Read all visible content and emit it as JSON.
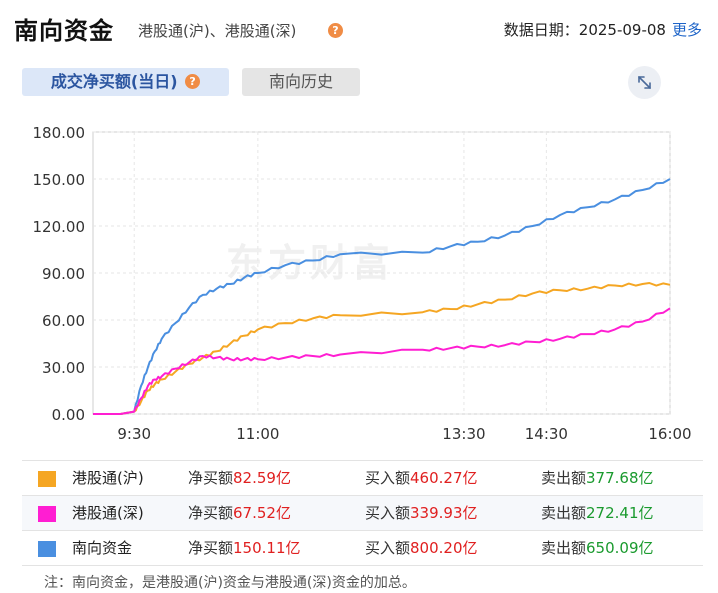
{
  "header": {
    "title": "南向资金",
    "subtitle": "港股通(沪)、港股通(深)",
    "help": "?",
    "date_label": "数据日期：",
    "date_value": "2025-09-08",
    "more_label": "更多"
  },
  "tabs": [
    {
      "label": "成交净买额(当日)",
      "active": true
    },
    {
      "label": "南向历史",
      "active": false
    }
  ],
  "watermark": "东方财富",
  "chart_data": {
    "type": "line",
    "x_ticks": [
      "9:30",
      "11:00",
      "13:30",
      "14:30",
      "16:00"
    ],
    "y_ticks": [
      "0.00",
      "30.00",
      "60.00",
      "90.00",
      "120.00",
      "150.00",
      "180.00"
    ],
    "ylim": [
      0,
      180
    ],
    "grid": true,
    "series": [
      {
        "name": "南向资金",
        "color": "#4a8fe0",
        "x": [
          "9:00",
          "9:20",
          "9:30",
          "9:35",
          "9:40",
          "9:45",
          "9:50",
          "10:00",
          "10:10",
          "10:20",
          "10:30",
          "10:40",
          "10:50",
          "11:00",
          "11:20",
          "11:40",
          "12:00",
          "13:00",
          "13:20",
          "13:40",
          "14:00",
          "14:20",
          "14:40",
          "15:00",
          "15:20",
          "15:40",
          "16:00"
        ],
        "values": [
          0,
          0,
          1.5,
          18,
          30,
          40,
          48,
          58,
          68,
          76,
          80,
          83,
          87,
          90,
          95,
          98,
          102,
          103,
          107,
          110,
          114,
          120,
          127,
          132,
          137,
          143,
          150
        ]
      },
      {
        "name": "港股通(沪)",
        "color": "#f5a623",
        "x": [
          "9:00",
          "9:20",
          "9:30",
          "9:35",
          "9:40",
          "9:45",
          "9:50",
          "10:00",
          "10:10",
          "10:20",
          "10:30",
          "10:40",
          "10:50",
          "11:00",
          "11:20",
          "11:40",
          "12:00",
          "13:00",
          "13:20",
          "13:40",
          "14:00",
          "14:20",
          "14:40",
          "15:00",
          "15:20",
          "15:40",
          "16:00"
        ],
        "values": [
          0,
          0,
          1.5,
          8,
          15,
          19,
          22,
          27,
          32,
          36,
          40,
          45,
          50,
          54,
          58,
          61,
          63,
          65,
          67,
          70,
          73,
          77,
          79,
          80,
          82,
          83,
          82.5
        ]
      },
      {
        "name": "港股通(深)",
        "color": "#ff1ed2",
        "x": [
          "9:00",
          "9:20",
          "9:30",
          "9:35",
          "9:40",
          "9:45",
          "9:50",
          "10:00",
          "10:10",
          "10:20",
          "10:30",
          "10:40",
          "10:50",
          "11:00",
          "11:20",
          "11:40",
          "12:00",
          "13:00",
          "13:20",
          "13:40",
          "14:00",
          "14:20",
          "14:40",
          "15:00",
          "15:20",
          "15:40",
          "16:00"
        ],
        "values": [
          0,
          0,
          1.5,
          10,
          18,
          22,
          24,
          29,
          33,
          37,
          36,
          35,
          35,
          35,
          36,
          37,
          38,
          41,
          42,
          43,
          44,
          46,
          48,
          51,
          54,
          59,
          67.5
        ]
      }
    ]
  },
  "legend": [
    {
      "name": "港股通(沪)",
      "color": "#f5a623",
      "net_label": "净买额",
      "net_value": "82.59亿",
      "buy_label": "买入额",
      "buy_value": "460.27亿",
      "sell_label": "卖出额",
      "sell_value": "377.68亿"
    },
    {
      "name": "港股通(深)",
      "color": "#ff1ed2",
      "net_label": "净买额",
      "net_value": "67.52亿",
      "buy_label": "买入额",
      "buy_value": "339.93亿",
      "sell_label": "卖出额",
      "sell_value": "272.41亿"
    },
    {
      "name": "南向资金",
      "color": "#4a8fe0",
      "net_label": "净买额",
      "net_value": "150.11亿",
      "buy_label": "买入额",
      "buy_value": "800.20亿",
      "sell_label": "卖出额",
      "sell_value": "650.09亿"
    }
  ],
  "note": "注：南向资金，是港股通(沪)资金与港股通(深)资金的加总。"
}
